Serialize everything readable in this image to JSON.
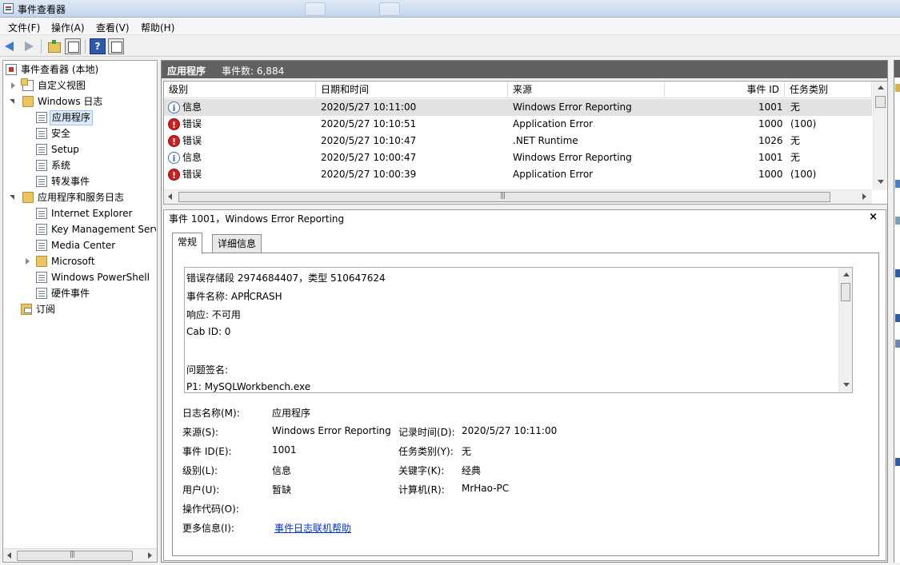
{
  "window": {
    "title": "事件查看器"
  },
  "menu": [
    {
      "label": "文件(F)"
    },
    {
      "label": "操作(A)"
    },
    {
      "label": "查看(V)"
    },
    {
      "label": "帮助(H)"
    }
  ],
  "toolbar": {
    "back": "back-arrow-icon",
    "forward": "forward-arrow-icon",
    "help": "?"
  },
  "tree": {
    "root": "事件查看器 (本地)",
    "custom_views": "自定义视图",
    "windows_logs": "Windows 日志",
    "windows_log_items": [
      "应用程序",
      "安全",
      "Setup",
      "系统",
      "转发事件"
    ],
    "app_service_logs": "应用程序和服务日志",
    "app_service_items": [
      "Internet Explorer",
      "Key Management Serv",
      "Media Center",
      "Microsoft",
      "Windows PowerShell",
      "硬件事件"
    ],
    "subscriptions": "订阅",
    "selected": "应用程序"
  },
  "center": {
    "title": "应用程序",
    "count_label": "事件数: 6,884"
  },
  "grid": {
    "columns": [
      "级别",
      "日期和时间",
      "来源",
      "事件 ID",
      "任务类别"
    ],
    "rows": [
      {
        "level": "信息",
        "icon": "info",
        "datetime": "2020/5/27 10:11:00",
        "source": "Windows Error Reporting",
        "event_id": "1001",
        "category": "无"
      },
      {
        "level": "错误",
        "icon": "error",
        "datetime": "2020/5/27 10:10:51",
        "source": "Application Error",
        "event_id": "1000",
        "category": "(100)"
      },
      {
        "level": "错误",
        "icon": "error",
        "datetime": "2020/5/27 10:10:47",
        "source": ".NET Runtime",
        "event_id": "1026",
        "category": "无"
      },
      {
        "level": "信息",
        "icon": "info",
        "datetime": "2020/5/27 10:00:47",
        "source": "Windows Error Reporting",
        "event_id": "1001",
        "category": "无"
      },
      {
        "level": "错误",
        "icon": "error",
        "datetime": "2020/5/27 10:00:39",
        "source": "Application Error",
        "event_id": "1000",
        "category": "(100)"
      }
    ]
  },
  "detail": {
    "title": "事件 1001，Windows Error Reporting",
    "close": "×",
    "tabs": [
      "常规",
      "详细信息"
    ],
    "description_lines": [
      "错误存储段 2974684407，类型 510647624",
      "事件名称: APPCRASH",
      "响应: 不可用",
      "Cab ID: 0",
      "",
      "问题签名:",
      "P1: MySQLWorkbench.exe"
    ],
    "fields": {
      "log_name_label": "日志名称(M):",
      "log_name": "应用程序",
      "source_label": "来源(S):",
      "source": "Windows Error Reporting",
      "logged_label": "记录时间(D):",
      "logged": "2020/5/27 10:11:00",
      "event_id_label": "事件 ID(E):",
      "event_id": "1001",
      "task_label": "任务类别(Y):",
      "task": "无",
      "level_label": "级别(L):",
      "level": "信息",
      "keywords_label": "关键字(K):",
      "keywords": "经典",
      "user_label": "用户(U):",
      "user": "暂缺",
      "computer_label": "计算机(R):",
      "computer": "MrHao-PC",
      "opcode_label": "操作代码(O):",
      "more_info_label": "更多信息(I):",
      "more_info_link": "事件日志联机帮助"
    }
  }
}
